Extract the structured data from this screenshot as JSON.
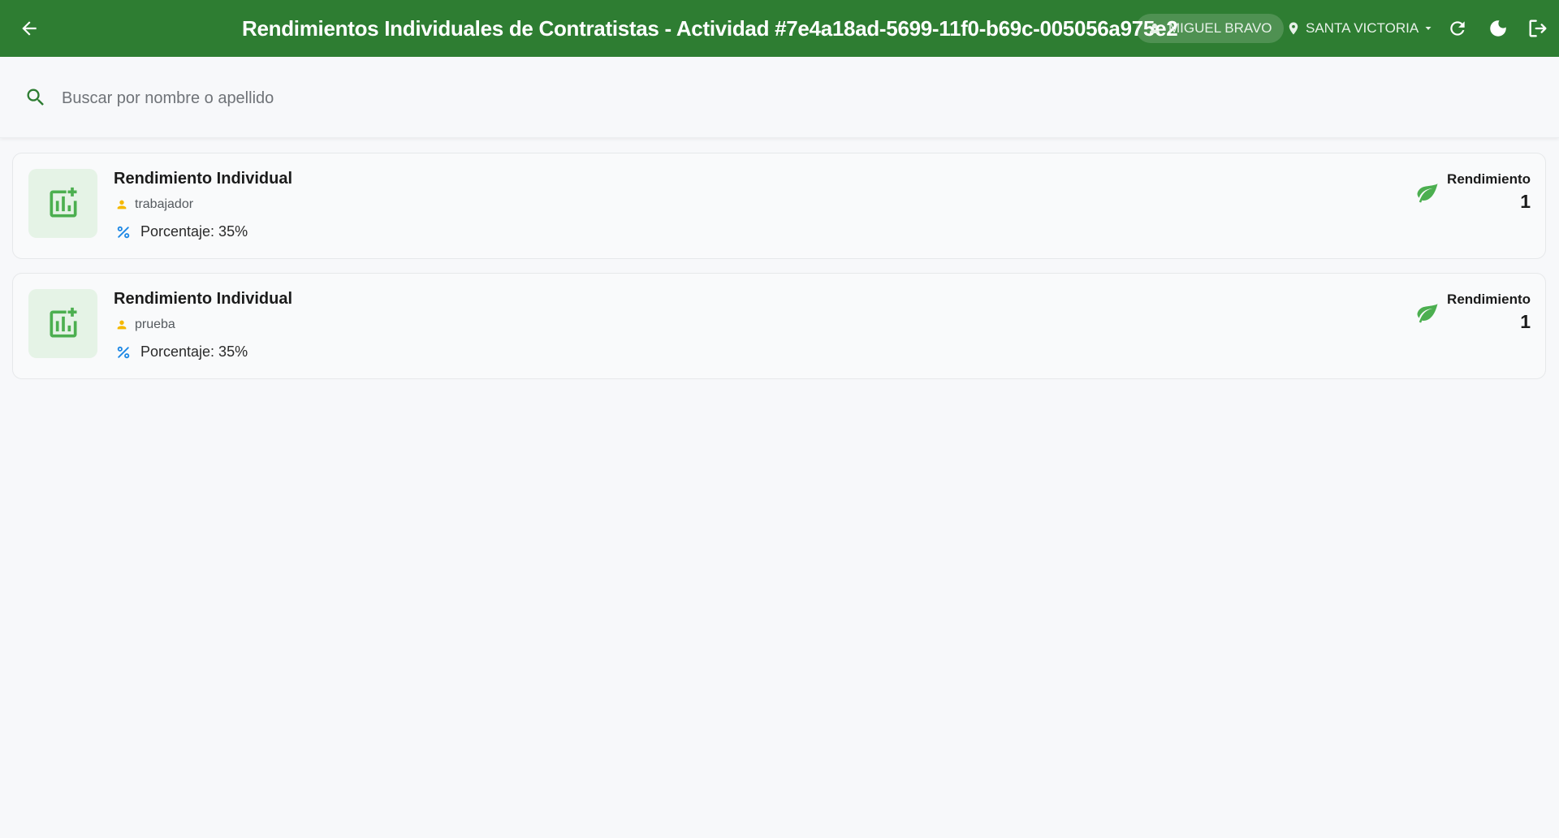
{
  "header": {
    "title": "Rendimientos Individuales de Contratistas - Actividad #7e4a18ad-5699-11f0-b69c-005056a975e2",
    "user_name": "MIGUEL BRAVO",
    "site_name": "SANTA VICTORIA",
    "icons": {
      "back": "arrow-left-icon",
      "user": "person-icon",
      "site": "location-pin-icon",
      "site_dropdown": "caret-down-icon",
      "refresh": "refresh-icon",
      "theme": "moon-icon",
      "logout": "logout-icon"
    }
  },
  "search": {
    "placeholder": "Buscar por nombre o apellido",
    "value": ""
  },
  "colors": {
    "primary": "#2e7d32",
    "accent_green": "#4caf50",
    "person_icon": "#f5b800",
    "percent_icon": "#1e88e5",
    "background": "#f7f8fa"
  },
  "cards": [
    {
      "title": "Rendimiento Individual",
      "worker": "trabajador",
      "percentage": "Porcentaje: 35%",
      "performance_label": "Rendimiento",
      "performance_value": "1"
    },
    {
      "title": "Rendimiento Individual",
      "worker": "prueba",
      "percentage": "Porcentaje: 35%",
      "performance_label": "Rendimiento",
      "performance_value": "1"
    }
  ]
}
